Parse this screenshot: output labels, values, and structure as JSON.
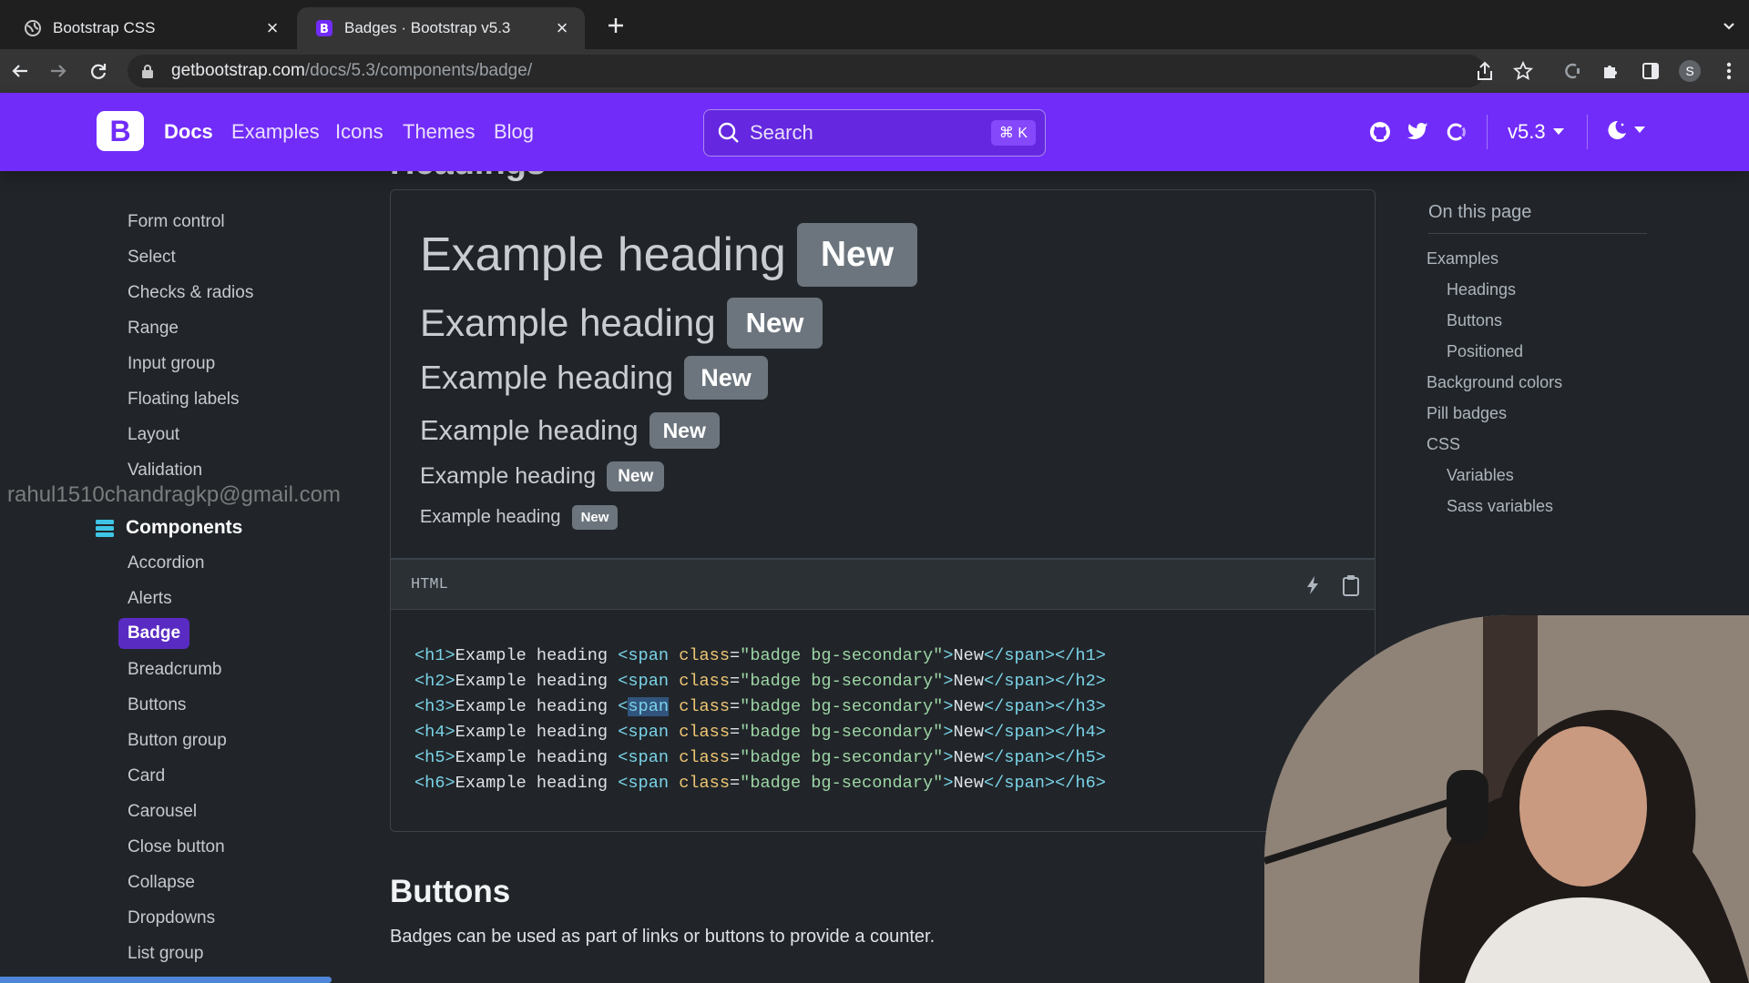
{
  "browser": {
    "tabs": [
      {
        "label": "Bootstrap CSS",
        "active": false
      },
      {
        "label": "Badges · Bootstrap v5.3",
        "active": true
      }
    ],
    "url_host": "getbootstrap.com",
    "url_path": "/docs/5.3/components/badge/",
    "profile_initial": "S"
  },
  "navbar": {
    "logo": "B",
    "links": [
      "Docs",
      "Examples",
      "Icons",
      "Themes",
      "Blog"
    ],
    "active_link": "Docs",
    "search_placeholder": "Search",
    "search_shortcut": "⌘ K",
    "version": "v5.3",
    "brand_color": "#712cf9"
  },
  "watermark": "rahul1510chandragkp@gmail.com",
  "sidebar": {
    "forms_items": [
      "Form control",
      "Select",
      "Checks & radios",
      "Range",
      "Input group",
      "Floating labels",
      "Layout",
      "Validation"
    ],
    "components_header": "Components",
    "components_items": [
      "Accordion",
      "Alerts",
      "Badge",
      "Breadcrumb",
      "Buttons",
      "Button group",
      "Card",
      "Carousel",
      "Close button",
      "Collapse",
      "Dropdowns",
      "List group"
    ],
    "active_item": "Badge"
  },
  "content": {
    "clipped_heading": "Headings",
    "examples": [
      {
        "text": "Example heading",
        "badge": "New"
      },
      {
        "text": "Example heading",
        "badge": "New"
      },
      {
        "text": "Example heading",
        "badge": "New"
      },
      {
        "text": "Example heading",
        "badge": "New"
      },
      {
        "text": "Example heading",
        "badge": "New"
      },
      {
        "text": "Example heading",
        "badge": "New"
      }
    ],
    "code_lang": "HTML",
    "code_lines": [
      {
        "open": "h1",
        "text": "Example heading",
        "cls": "\"badge bg-secondary\"",
        "badge": "New"
      },
      {
        "open": "h2",
        "text": "Example heading",
        "cls": "\"badge bg-secondary\"",
        "badge": "New"
      },
      {
        "open": "h3",
        "text": "Example heading",
        "cls": "\"badge bg-secondary\"",
        "badge": "New"
      },
      {
        "open": "h4",
        "text": "Example heading",
        "cls": "\"badge bg-secondary\"",
        "badge": "New"
      },
      {
        "open": "h5",
        "text": "Example heading",
        "cls": "\"badge bg-secondary\"",
        "badge": "New"
      },
      {
        "open": "h6",
        "text": "Example heading",
        "cls": "\"badge bg-secondary\"",
        "badge": "New"
      }
    ],
    "buttons_heading": "Buttons",
    "buttons_text": "Badges can be used as part of links or buttons to provide a counter."
  },
  "toc": {
    "title": "On this page",
    "items": [
      {
        "label": "Examples",
        "level": 1
      },
      {
        "label": "Headings",
        "level": 2
      },
      {
        "label": "Buttons",
        "level": 2
      },
      {
        "label": "Positioned",
        "level": 2
      },
      {
        "label": "Background colors",
        "level": 1
      },
      {
        "label": "Pill badges",
        "level": 1
      },
      {
        "label": "CSS",
        "level": 1
      },
      {
        "label": "Variables",
        "level": 2
      },
      {
        "label": "Sass variables",
        "level": 2
      }
    ]
  }
}
